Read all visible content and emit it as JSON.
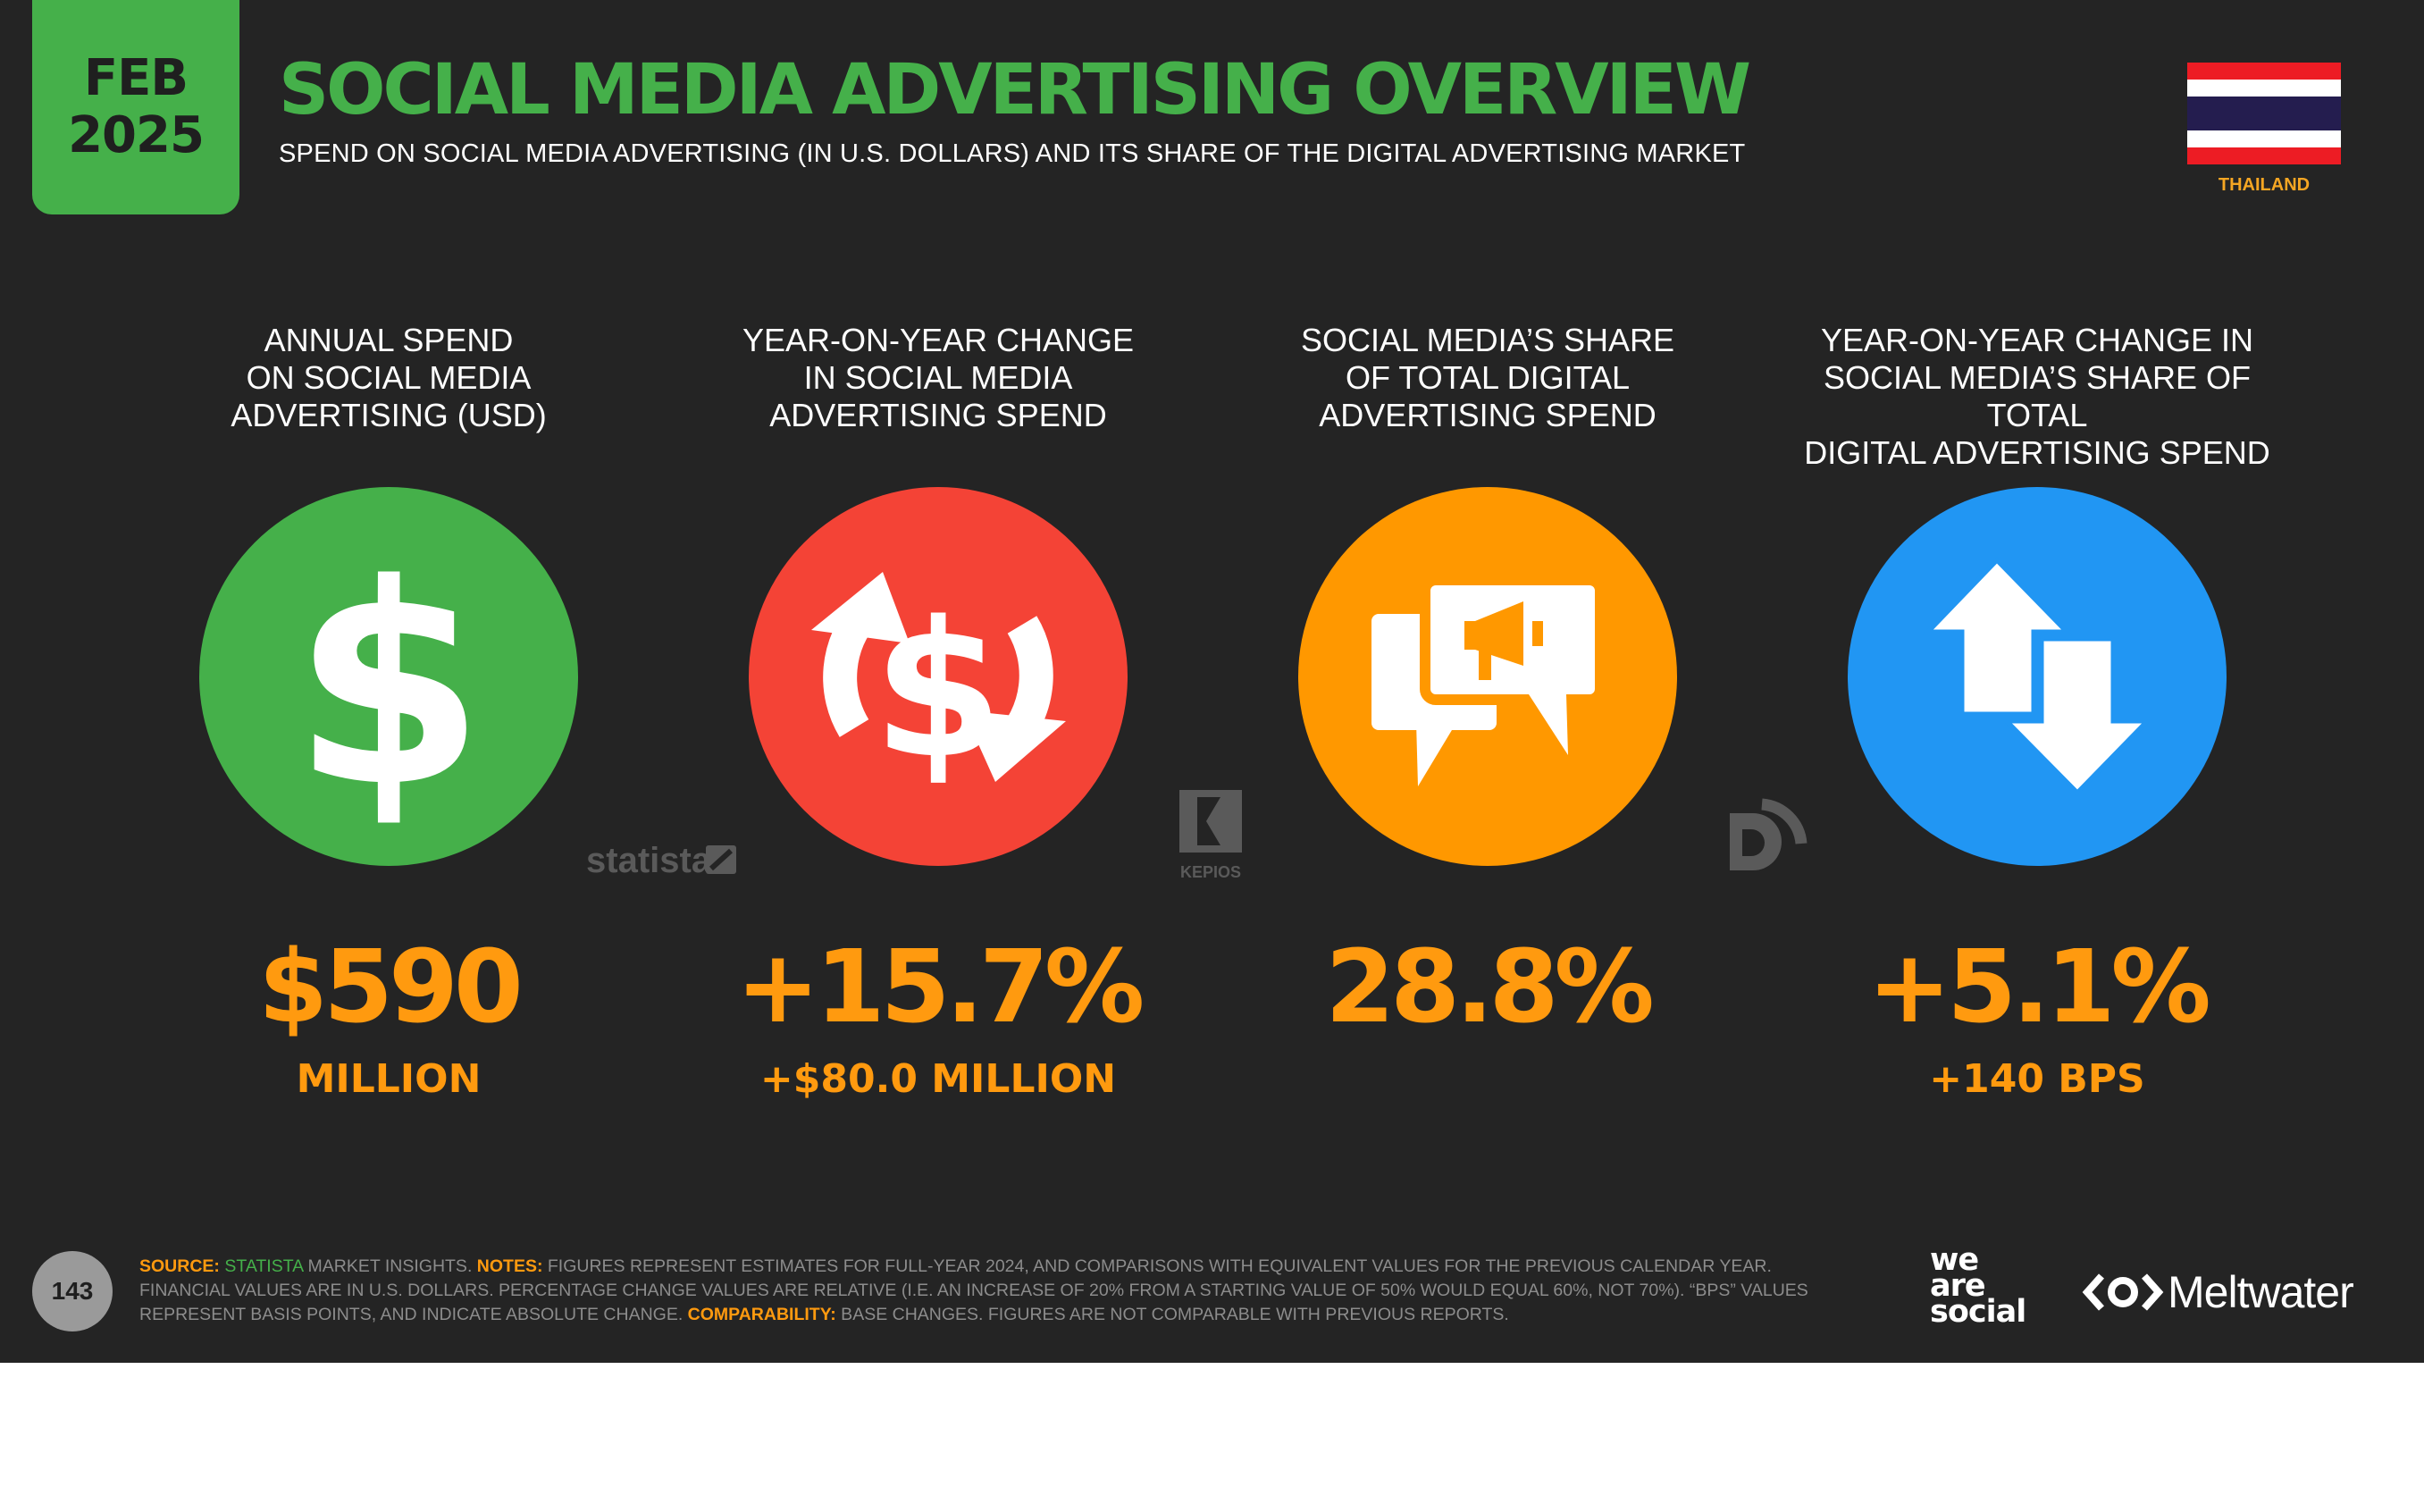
{
  "header": {
    "date_month": "FEB",
    "date_year": "2025",
    "title": "SOCIAL MEDIA ADVERTISING OVERVIEW",
    "subtitle": "SPEND ON SOCIAL MEDIA ADVERTISING (IN U.S. DOLLARS) AND ITS SHARE OF THE DIGITAL ADVERTISING MARKET",
    "country": "THAILAND",
    "flag_colors": [
      "#ED1C24",
      "#FFFFFF",
      "#241D4F"
    ]
  },
  "stats": [
    {
      "label": "ANNUAL SPEND\nON SOCIAL MEDIA\nADVERTISING (USD)",
      "value": "$590",
      "sub": "MILLION",
      "icon": "dollar-icon",
      "color": "#45B04A"
    },
    {
      "label": "YEAR-ON-YEAR CHANGE\nIN SOCIAL MEDIA\nADVERTISING SPEND",
      "value": "+15.7%",
      "sub": "+$80.0 MILLION",
      "icon": "dollar-cycle-icon",
      "color": "#F44336"
    },
    {
      "label": "SOCIAL MEDIA’S SHARE\nOF TOTAL DIGITAL\nADVERTISING SPEND",
      "value": "28.8%",
      "sub": "",
      "icon": "megaphone-chat-icon",
      "color": "#FF9800"
    },
    {
      "label": "YEAR-ON-YEAR CHANGE IN\nSOCIAL MEDIA’S SHARE OF TOTAL\nDIGITAL ADVERTISING SPEND",
      "value": "+5.1%",
      "sub": "+140 BPS",
      "icon": "up-down-arrows-icon",
      "color": "#2196F3"
    }
  ],
  "source_logos": {
    "statista": "statista",
    "kepios": "KEPIOS"
  },
  "footer": {
    "page_number": "143",
    "source_key": "SOURCE:",
    "source_name": "STATISTA",
    "source_rest": " MARKET INSIGHTS. ",
    "notes_key": "NOTES:",
    "notes_text": " FIGURES REPRESENT ESTIMATES FOR FULL-YEAR 2024, AND COMPARISONS WITH EQUIVALENT VALUES FOR THE PREVIOUS CALENDAR YEAR. FINANCIAL VALUES ARE IN U.S. DOLLARS. PERCENTAGE CHANGE VALUES ARE RELATIVE (I.E. AN INCREASE OF 20% FROM A STARTING VALUE OF 50% WOULD EQUAL 60%, NOT 70%). “BPS” VALUES REPRESENT BASIS POINTS, AND INDICATE ABSOLUTE CHANGE. ",
    "comparability_key": "COMPARABILITY:",
    "comparability_text": " BASE CHANGES. FIGURES ARE NOT COMPARABLE WITH PREVIOUS REPORTS.",
    "brand_we_are_social": [
      "we",
      "are",
      "social"
    ],
    "brand_meltwater": "Meltwater"
  }
}
